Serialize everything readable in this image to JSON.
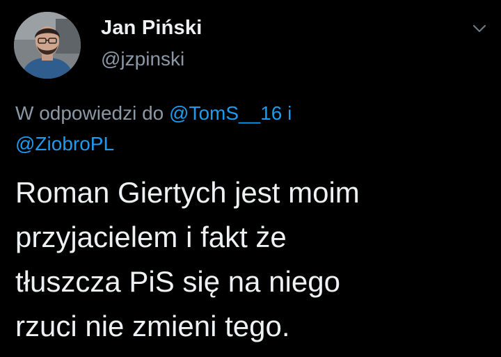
{
  "author": {
    "display_name": "Jan Piński",
    "handle": "@jzpinski",
    "avatar_icon": "avatar-photo"
  },
  "menu": {
    "icon": "chevron-down-icon"
  },
  "reply_context": {
    "prefix": "W odpowiedzi do ",
    "mention_1": "@TomS__16",
    "joiner": " i",
    "mention_2": "@ZiobroPL"
  },
  "tweet": {
    "lines": [
      "Roman Giertych jest moim",
      "przyjacielem i fakt że",
      "tłuszcza PiS się na niego",
      "rzuci nie zmieni tego."
    ]
  },
  "colors": {
    "background": "#000000",
    "primary_text": "#eef1f2",
    "secondary_text": "#8b98a5",
    "link": "#1d9bf0"
  }
}
